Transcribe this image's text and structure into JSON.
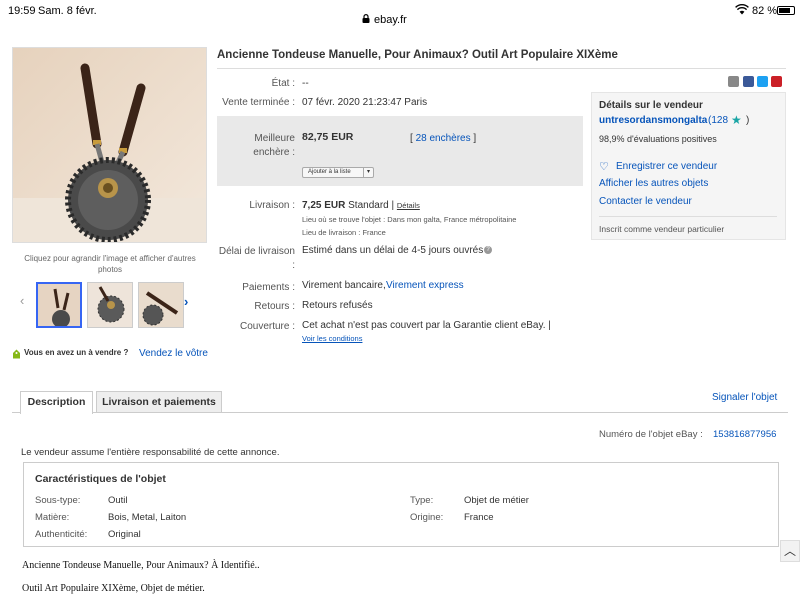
{
  "status_bar": {
    "time": "19:59",
    "date": "Sam. 8 févr.",
    "url": "ebay.fr",
    "battery": "82 %",
    "battery_level": 0.82
  },
  "gallery": {
    "caption": "Cliquez pour agrandir l'image et afficher d'autres photos",
    "sell_question": "Vous en avez un à vendre ?",
    "sell_link": "Vendez le vôtre"
  },
  "item": {
    "title": "Ancienne Tondeuse Manuelle, Pour Animaux? Outil Art Populaire XIXème",
    "state_label": "État :",
    "state_value": "--",
    "end_label": "Vente terminée :",
    "end_value": "07 févr. 2020  21:23:47 Paris",
    "best_bid_label": "Meilleure enchère :",
    "best_bid_value": "82,75 EUR",
    "bids_link": "28 enchères",
    "watch_button": "Ajouter à la liste",
    "shipping_label": "Livraison :",
    "shipping_price": "7,25 EUR",
    "shipping_type": "Standard",
    "shipping_details": "Détails",
    "item_location": "Lieu où se trouve l'objet :  Dans mon galta, France métropolitaine",
    "ship_to": "Lieu de livraison :  France",
    "delay_label": "Délai de livraison :",
    "delay_value": "Estimé dans un délai de 4-5 jours ouvrés",
    "payments_label": "Paiements :",
    "payments_value": "Virement bancaire,",
    "payments_link": "Virement express",
    "returns_label": "Retours :",
    "returns_value": "Retours refusés",
    "coverage_label": "Couverture :",
    "coverage_value": "Cet achat n'est pas couvert par la Garantie client eBay. |",
    "coverage_link": "Voir les conditions"
  },
  "seller": {
    "heading": "Détails sur le vendeur",
    "name": "untresordansmongalta",
    "score": "(128",
    "score_close": ")",
    "feedback": "98,9% d'évaluations positives",
    "save_seller": "Enregistrer ce vendeur",
    "other_items": "Afficher les autres objets",
    "contact": "Contacter le vendeur",
    "registered": "Inscrit comme vendeur particulier"
  },
  "tabs": {
    "description": "Description",
    "shipping": "Livraison et paiements",
    "report": "Signaler l'objet"
  },
  "desc_section": {
    "item_number_label": "Numéro de l'objet eBay :",
    "item_number": "153816877956",
    "responsibility": "Le vendeur assume l'entière responsabilité de cette annonce.",
    "specs_title": "Caractéristiques de l'objet",
    "specs": {
      "subtype_label": "Sous-type:",
      "subtype_value": "Outil",
      "type_label": "Type:",
      "type_value": "Objet de métier",
      "material_label": "Matière:",
      "material_value": "Bois, Metal, Laiton",
      "origin_label": "Origine:",
      "origin_value": "France",
      "authenticity_label": "Authenticité:",
      "authenticity_value": "Original"
    },
    "desc_line1": "Ancienne Tondeuse Manuelle, Pour Animaux? À Identifié..",
    "desc_line2": "Outil Art Populaire XIXème, Objet de métier."
  },
  "colors": {
    "link": "#0654ba",
    "bid_box": "#e9e9e9",
    "seller_box": "#f5f5f5"
  }
}
